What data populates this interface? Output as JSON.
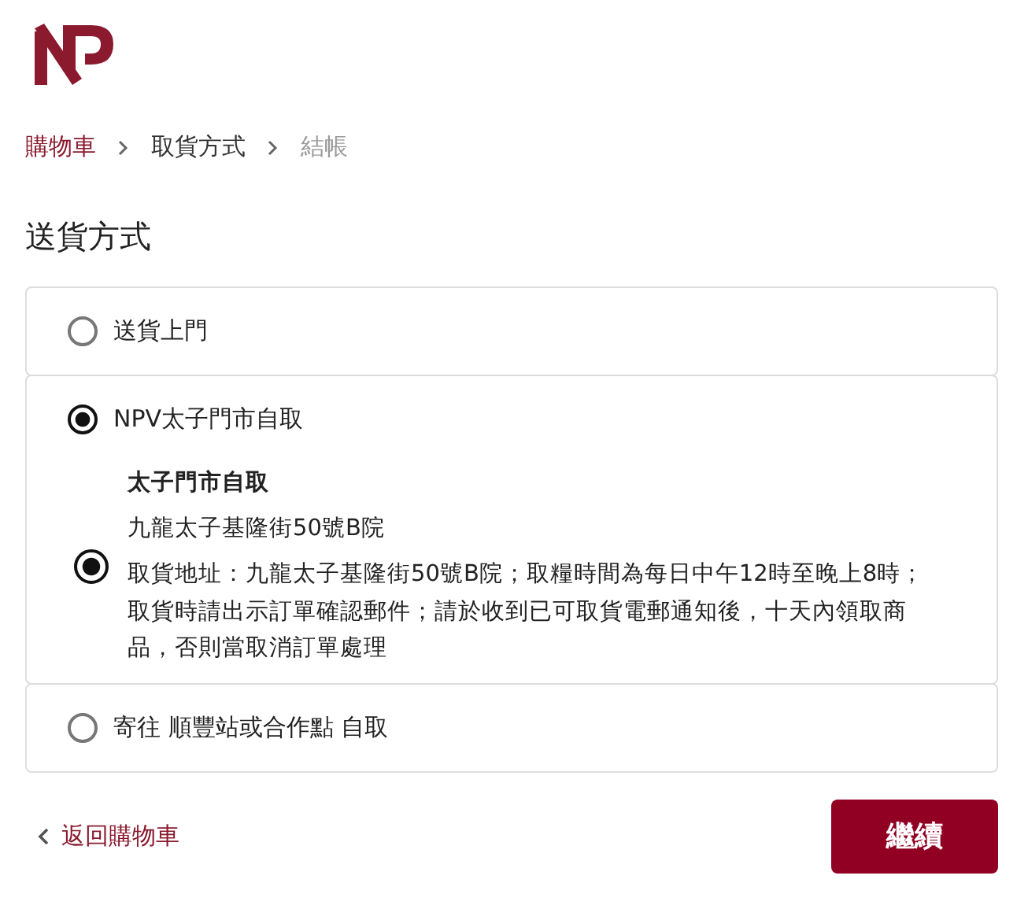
{
  "breadcrumb": [
    {
      "label": "購物車",
      "kind": "link"
    },
    {
      "label": "取貨方式",
      "kind": "current"
    },
    {
      "label": "結帳",
      "kind": "pending"
    }
  ],
  "heading": "送貨方式",
  "options": [
    {
      "label": "送貨上門",
      "selected": false
    },
    {
      "label": "NPV太子門市自取",
      "selected": true,
      "stores": [
        {
          "name": "太子門市自取",
          "address": "九龍太子基隆街50號B院",
          "note": "取貨地址：九龍太子基隆街50號B院；取糧時間為每日中午12時至晚上8時；取貨時請出示訂單確認郵件；請於收到已可取貨電郵通知後，十天內領取商品，否則當取消訂單處理",
          "selected": true
        }
      ]
    },
    {
      "label": "寄往 順豐站或合作點 自取",
      "selected": false
    }
  ],
  "back_link": "返回購物車",
  "continue_button": "繼續"
}
